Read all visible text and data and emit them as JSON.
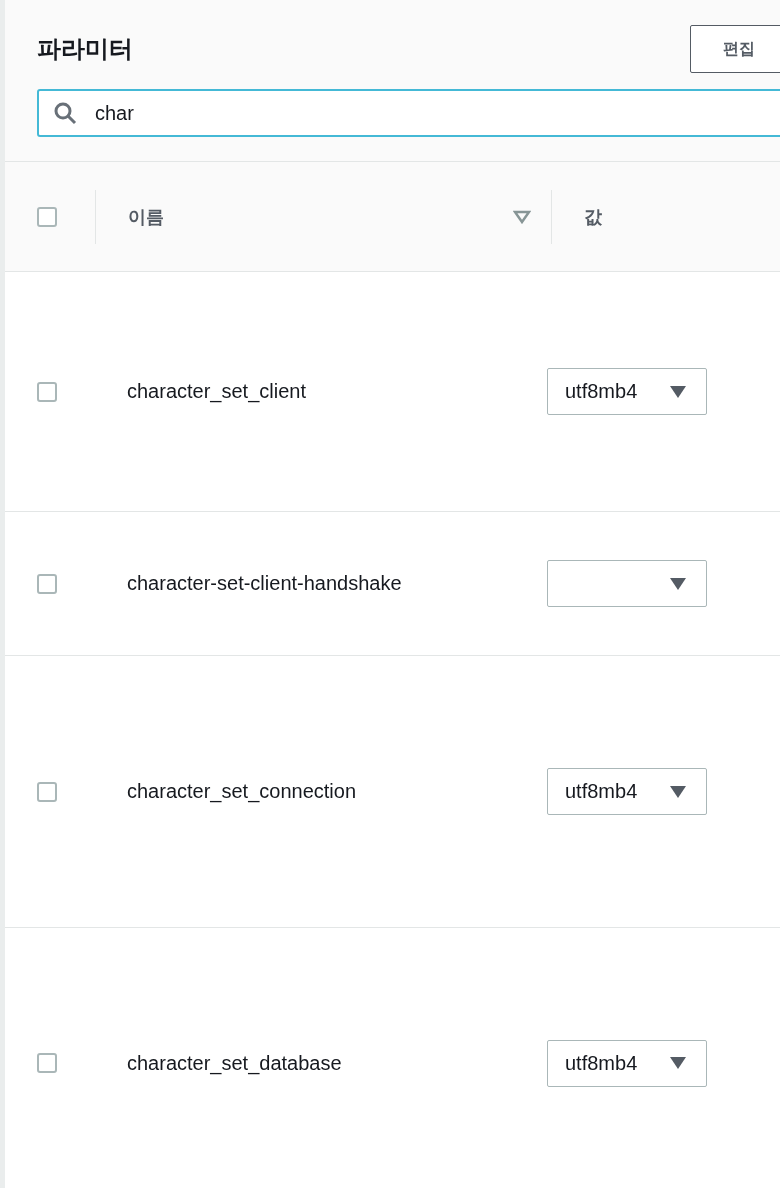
{
  "title": "파라미터",
  "edit_button": "편집",
  "search": {
    "value": "char"
  },
  "table": {
    "select_all": {
      "checked": false
    },
    "columns": [
      {
        "label": "이름",
        "sortable": true
      },
      {
        "label": "값",
        "sortable": false
      }
    ],
    "rows": [
      {
        "checked": false,
        "name": "character_set_client",
        "value": "utf8mb4"
      },
      {
        "checked": false,
        "name": "character-set-client-handshake"
      },
      {
        "checked": false,
        "name": "character_set_connection",
        "value": "utf8mb4"
      },
      {
        "checked": false,
        "name": "character_set_database",
        "value": "utf8mb4"
      }
    ]
  }
}
